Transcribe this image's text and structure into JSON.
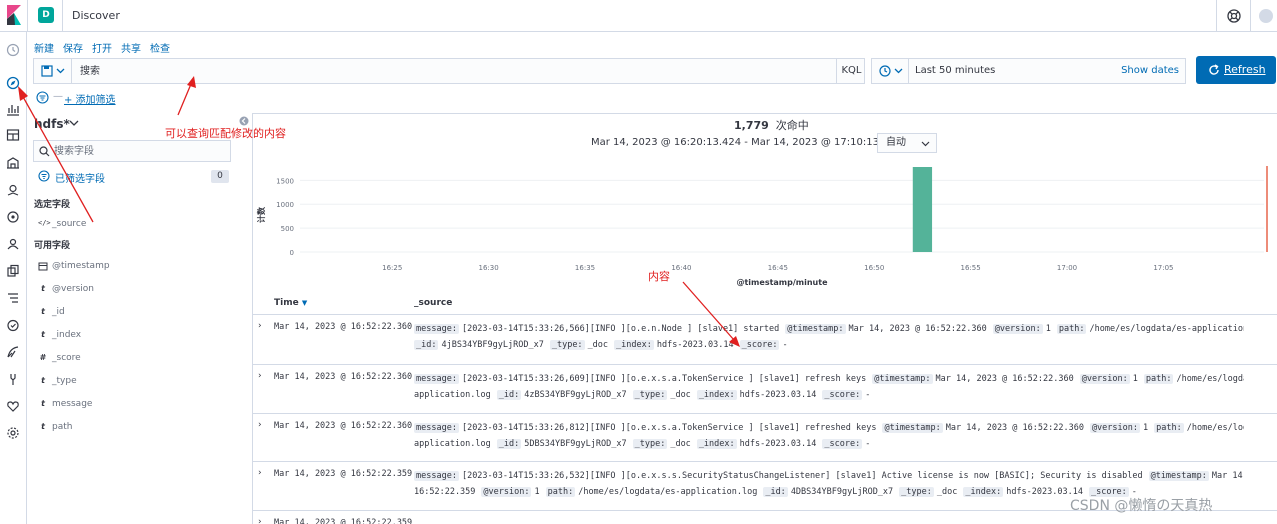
{
  "header": {
    "app_title": "Discover",
    "space_initial": "D"
  },
  "menu": [
    "新建",
    "保存",
    "打开",
    "共享",
    "检查"
  ],
  "query": {
    "placeholder": "搜索",
    "language": "KQL"
  },
  "time": {
    "range": "Last 50 minutes",
    "show_dates": "Show dates",
    "refresh_label": "Refresh"
  },
  "filters": {
    "add_filter": "+ 添加筛选"
  },
  "sidebar": {
    "index_pattern": "hdfs*",
    "search_placeholder": "搜索字段",
    "selected_filter_label": "已筛选字段",
    "selected_filter_count": "0",
    "selected_fields_title": "选定字段",
    "selected_fields": [
      {
        "type": "</>",
        "name": "_source"
      }
    ],
    "available_fields_title": "可用字段",
    "available_fields": [
      {
        "type": "cal",
        "name": "@timestamp"
      },
      {
        "type": "t",
        "name": "@version"
      },
      {
        "type": "t",
        "name": "_id"
      },
      {
        "type": "t",
        "name": "_index"
      },
      {
        "type": "#",
        "name": "_score"
      },
      {
        "type": "t",
        "name": "_type"
      },
      {
        "type": "t",
        "name": "message"
      },
      {
        "type": "t",
        "name": "path"
      }
    ]
  },
  "histogram": {
    "hits_count": "1,779",
    "hits_label": "次命中",
    "date_range": "Mar 14, 2023 @ 16:20:13.424 - Mar 14, 2023 @ 17:10:13.424 —",
    "interval": "自动"
  },
  "chart_data": {
    "type": "bar",
    "x": [
      "16:52"
    ],
    "values": [
      1779
    ],
    "x_ticks": [
      "16:25",
      "16:30",
      "16:35",
      "16:40",
      "16:45",
      "16:50",
      "16:55",
      "17:00",
      "17:05"
    ],
    "y_ticks": [
      "1500",
      "1000",
      "500",
      "0"
    ],
    "ylabel": "计数",
    "xlabel": "@timestamp/minute",
    "ylim": [
      0,
      1800
    ],
    "grid": true,
    "bar_color": "#54b399",
    "marker_color": "#e7664c"
  },
  "table": {
    "col_time": "Time",
    "col_source": "_source",
    "rows": [
      {
        "time": "Mar 14, 2023 @ 16:52:22.360",
        "line1": [
          {
            "k": "message:",
            "v": "[2023-03-14T15:33:26,566][INFO ][o.e.n.Node ] [slave1] started"
          },
          {
            "k": "@timestamp:",
            "v": "Mar 14, 2023 @ 16:52:22.360"
          },
          {
            "k": "@version:",
            "v": "1"
          },
          {
            "k": "path:",
            "v": "/home/es/logdata/es-application.log"
          }
        ],
        "line2": [
          {
            "k": "_id:",
            "v": "4jBS34YBF9gyLjROD_x7"
          },
          {
            "k": "_type:",
            "v": "_doc"
          },
          {
            "k": "_index:",
            "v": "hdfs-2023.03.14"
          },
          {
            "k": "_score:",
            "v": "-"
          }
        ]
      },
      {
        "time": "Mar 14, 2023 @ 16:52:22.360",
        "line1": [
          {
            "k": "message:",
            "v": "[2023-03-14T15:33:26,609][INFO ][o.e.x.s.a.TokenService ] [slave1] refresh keys"
          },
          {
            "k": "@timestamp:",
            "v": "Mar 14, 2023 @ 16:52:22.360"
          },
          {
            "k": "@version:",
            "v": "1"
          },
          {
            "k": "path:",
            "v": "/home/es/logdata/es-"
          }
        ],
        "line2": [
          {
            "k": "",
            "v": "application.log"
          },
          {
            "k": "_id:",
            "v": "4zBS34YBF9gyLjROD_x7"
          },
          {
            "k": "_type:",
            "v": "_doc"
          },
          {
            "k": "_index:",
            "v": "hdfs-2023.03.14"
          },
          {
            "k": "_score:",
            "v": "-"
          }
        ]
      },
      {
        "time": "Mar 14, 2023 @ 16:52:22.360",
        "line1": [
          {
            "k": "message:",
            "v": "[2023-03-14T15:33:26,812][INFO ][o.e.x.s.a.TokenService ] [slave1] refreshed keys"
          },
          {
            "k": "@timestamp:",
            "v": "Mar 14, 2023 @ 16:52:22.360"
          },
          {
            "k": "@version:",
            "v": "1"
          },
          {
            "k": "path:",
            "v": "/home/es/logdata/es-"
          }
        ],
        "line2": [
          {
            "k": "",
            "v": "application.log"
          },
          {
            "k": "_id:",
            "v": "5DBS34YBF9gyLjROD_x7"
          },
          {
            "k": "_type:",
            "v": "_doc"
          },
          {
            "k": "_index:",
            "v": "hdfs-2023.03.14"
          },
          {
            "k": "_score:",
            "v": "-"
          }
        ]
      },
      {
        "time": "Mar 14, 2023 @ 16:52:22.359",
        "line1": [
          {
            "k": "message:",
            "v": "[2023-03-14T15:33:26,532][INFO ][o.e.x.s.s.SecurityStatusChangeListener] [slave1] Active license is now [BASIC]; Security is disabled"
          },
          {
            "k": "@timestamp:",
            "v": "Mar 14, 2023 @"
          }
        ],
        "line2": [
          {
            "k": "",
            "v": "16:52:22.359"
          },
          {
            "k": "@version:",
            "v": "1"
          },
          {
            "k": "path:",
            "v": "/home/es/logdata/es-application.log"
          },
          {
            "k": "_id:",
            "v": "4DBS34YBF9gyLjROD_x7"
          },
          {
            "k": "_type:",
            "v": "_doc"
          },
          {
            "k": "_index:",
            "v": "hdfs-2023.03.14"
          },
          {
            "k": "_score:",
            "v": "-"
          }
        ]
      },
      {
        "time": "Mar 14, 2023 @ 16:52:22.359",
        "line1": [],
        "line2": []
      }
    ]
  },
  "annotations": {
    "query_note": "可以查询匹配修改的内容",
    "content_note": "内容"
  },
  "watermark": "CSDN @懒惰の天真热"
}
